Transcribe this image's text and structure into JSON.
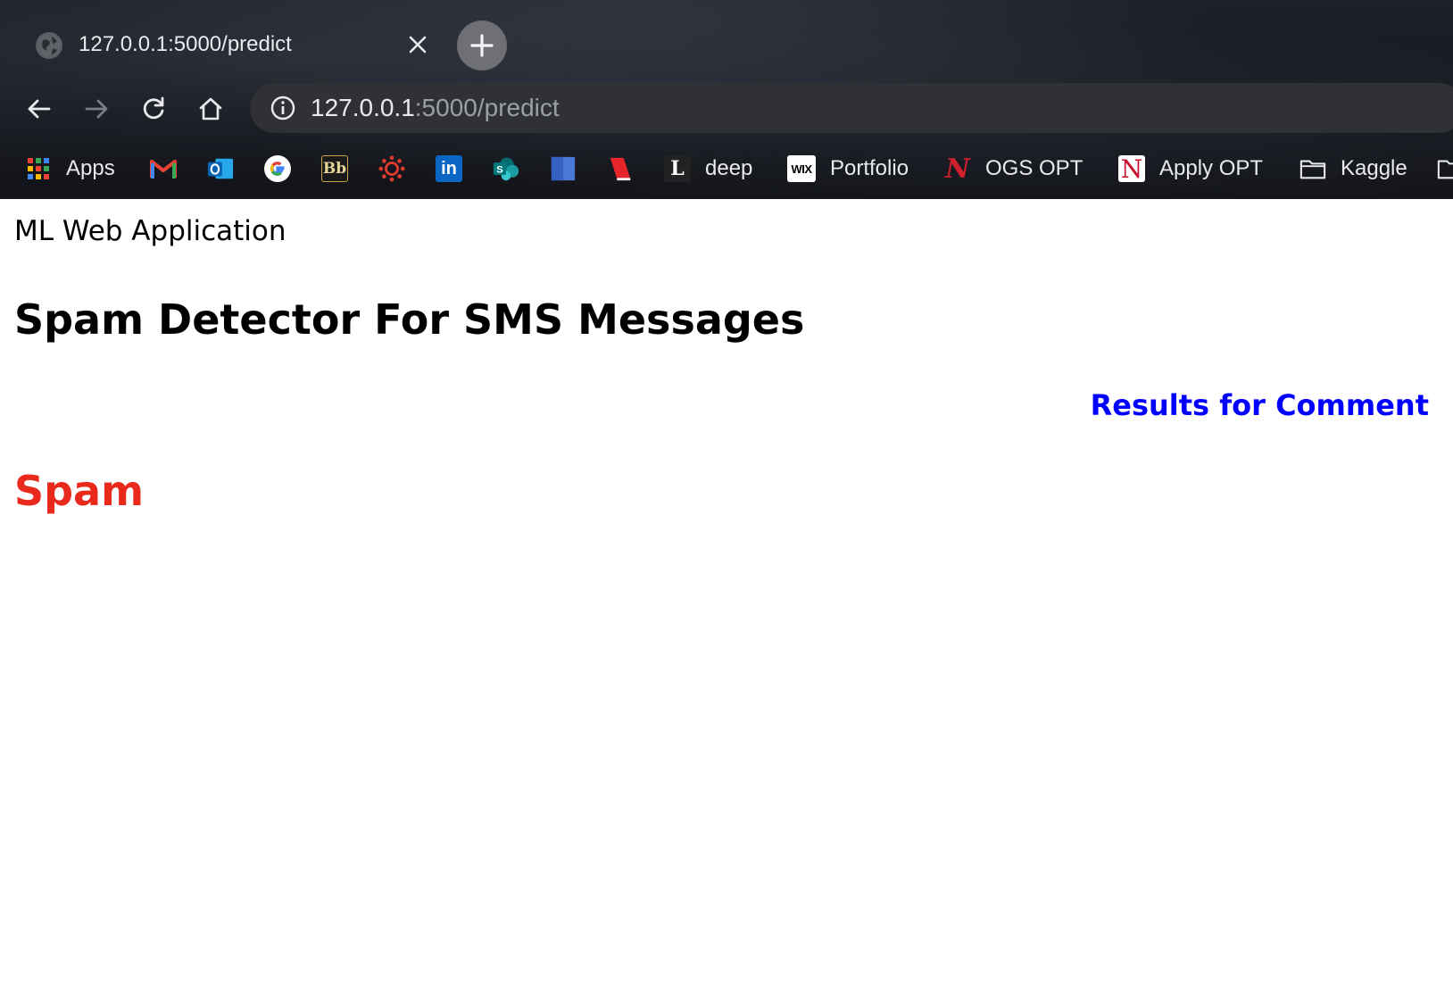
{
  "browser": {
    "tab": {
      "title": "127.0.0.1:5000/predict",
      "favicon": "globe-icon"
    },
    "new_tab_icon": "plus-icon",
    "address_bar": {
      "host": "127.0.0.1",
      "path": ":5000/predict",
      "info_icon": "info-icon"
    },
    "bookmarks": [
      {
        "label": "Apps",
        "icon": "apps-grid-icon"
      },
      {
        "label": "",
        "icon": "gmail-icon"
      },
      {
        "label": "",
        "icon": "outlook-icon"
      },
      {
        "label": "",
        "icon": "google-icon"
      },
      {
        "label": "",
        "icon": "blackboard-icon"
      },
      {
        "label": "",
        "icon": "canvas-icon"
      },
      {
        "label": "",
        "icon": "linkedin-icon"
      },
      {
        "label": "",
        "icon": "sharepoint-icon"
      },
      {
        "label": "",
        "icon": "blue-doc-icon"
      },
      {
        "label": "",
        "icon": "red-doc-icon"
      },
      {
        "label": "deep",
        "icon": "l-letter-icon"
      },
      {
        "label": "Portfolio",
        "icon": "wix-icon"
      },
      {
        "label": "OGS OPT",
        "icon": "n-logo-icon"
      },
      {
        "label": "Apply OPT",
        "icon": "n-seal-icon"
      },
      {
        "label": "Kaggle",
        "icon": "folder-icon"
      }
    ]
  },
  "page": {
    "app_title": "ML Web Application",
    "heading": "Spam Detector For SMS Messages",
    "results_label": "Results for Comment",
    "prediction": "Spam"
  },
  "colors": {
    "results_label": "#0000ff",
    "prediction": "#e8291c"
  }
}
